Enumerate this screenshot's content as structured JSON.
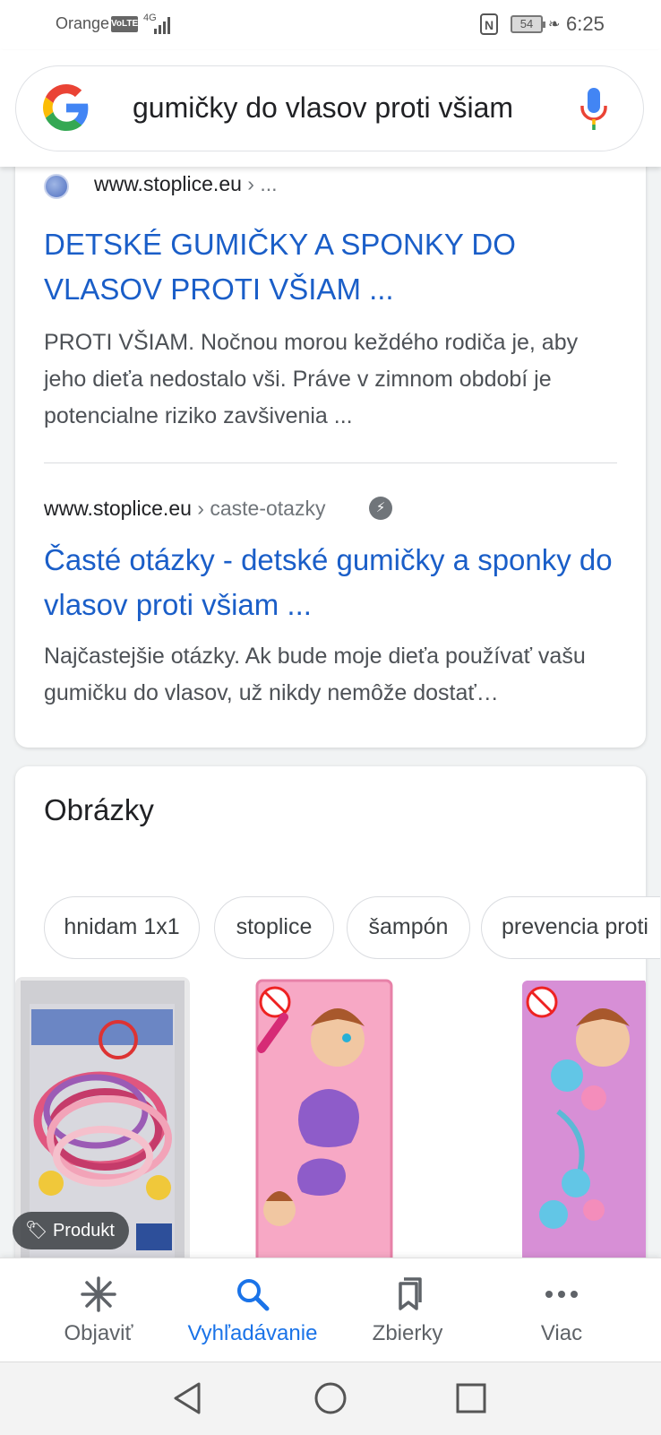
{
  "status_bar": {
    "carrier": "Orange",
    "volte": "VoLTE",
    "network": "4G",
    "battery": "54",
    "time": "6:25"
  },
  "search": {
    "query": "gumičky do vlasov proti všiam"
  },
  "results": [
    {
      "site": "www.stoplice.eu",
      "path": " › ...",
      "title": "DETSKÉ GUMIČKY A SPONKY DO VLASOV PROTI VŠIAM ...",
      "snippet": "PROTI VŠIAM. Nočnou morou keždého rodiča je, aby jeho dieťa nedostalo vši. Práve v zimnom období je potencialne riziko zavšivenia ..."
    },
    {
      "site": "www.stoplice.eu",
      "path": " › caste-otazky",
      "title": "Časté otázky - detské gumičky a sponky do vlasov proti všiam ...",
      "snippet": "Najčastejšie otázky. Ak bude moje dieťa používať vašu gumičku do vlasov, už nikdy nemôže dostať…"
    }
  ],
  "images_section": {
    "heading": "Obrázky",
    "chips": [
      "hnidam 1x1",
      "stoplice",
      "šampón",
      "prevencia proti"
    ],
    "badge": "Produkt"
  },
  "bottom_nav": [
    {
      "label": "Objaviť",
      "icon": "asterisk-icon"
    },
    {
      "label": "Vyhľadávanie",
      "icon": "search-icon"
    },
    {
      "label": "Zbierky",
      "icon": "bookmarks-icon"
    },
    {
      "label": "Viac",
      "icon": "more-dots-icon"
    }
  ],
  "colors": {
    "link": "#1a5ec8",
    "active": "#1a73e8"
  }
}
